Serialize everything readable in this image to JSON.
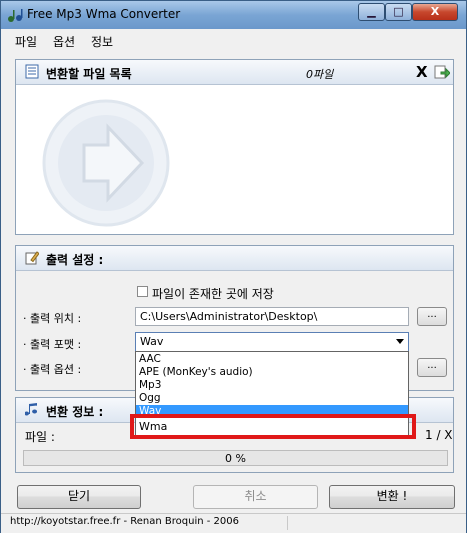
{
  "window": {
    "title": "Free Mp3 Wma Converter",
    "min": "▁",
    "max": "□",
    "close": "X"
  },
  "menu": [
    "파일",
    "옵션",
    "정보"
  ],
  "files_panel": {
    "title": "변환할 파일 목록",
    "count": "0파일",
    "remove_icon": "X"
  },
  "output_panel": {
    "title": "출력 설정 :",
    "save_same_label": "파일이 존재한 곳에 저장",
    "location_label": "· 출력 위치 :",
    "location_value": "C:\\Users\\Administrator\\Desktop\\",
    "format_label": "· 출력 포맷 :",
    "format_value": "Wav",
    "options_label": "· 출력 옵션 :",
    "browse": "...",
    "options_btn": "...",
    "format_options": [
      "AAC",
      "APE (MonKey's audio)",
      "Mp3",
      "Ogg",
      "Wav",
      "Wma"
    ],
    "selected_option": "Wav"
  },
  "convert_info": {
    "title": "변환 정보 :",
    "file_label": "파일 :",
    "file_count": "1 / X",
    "progress_text": "0 %",
    "progress_fraction": 0
  },
  "buttons": {
    "close": "닫기",
    "cancel": "취소",
    "convert": "변환 !"
  },
  "status": "http://koyotstar.free.fr - Renan Broquin - 2006",
  "colors": {
    "selection": "#3399ff",
    "highlight": "#e01818"
  }
}
